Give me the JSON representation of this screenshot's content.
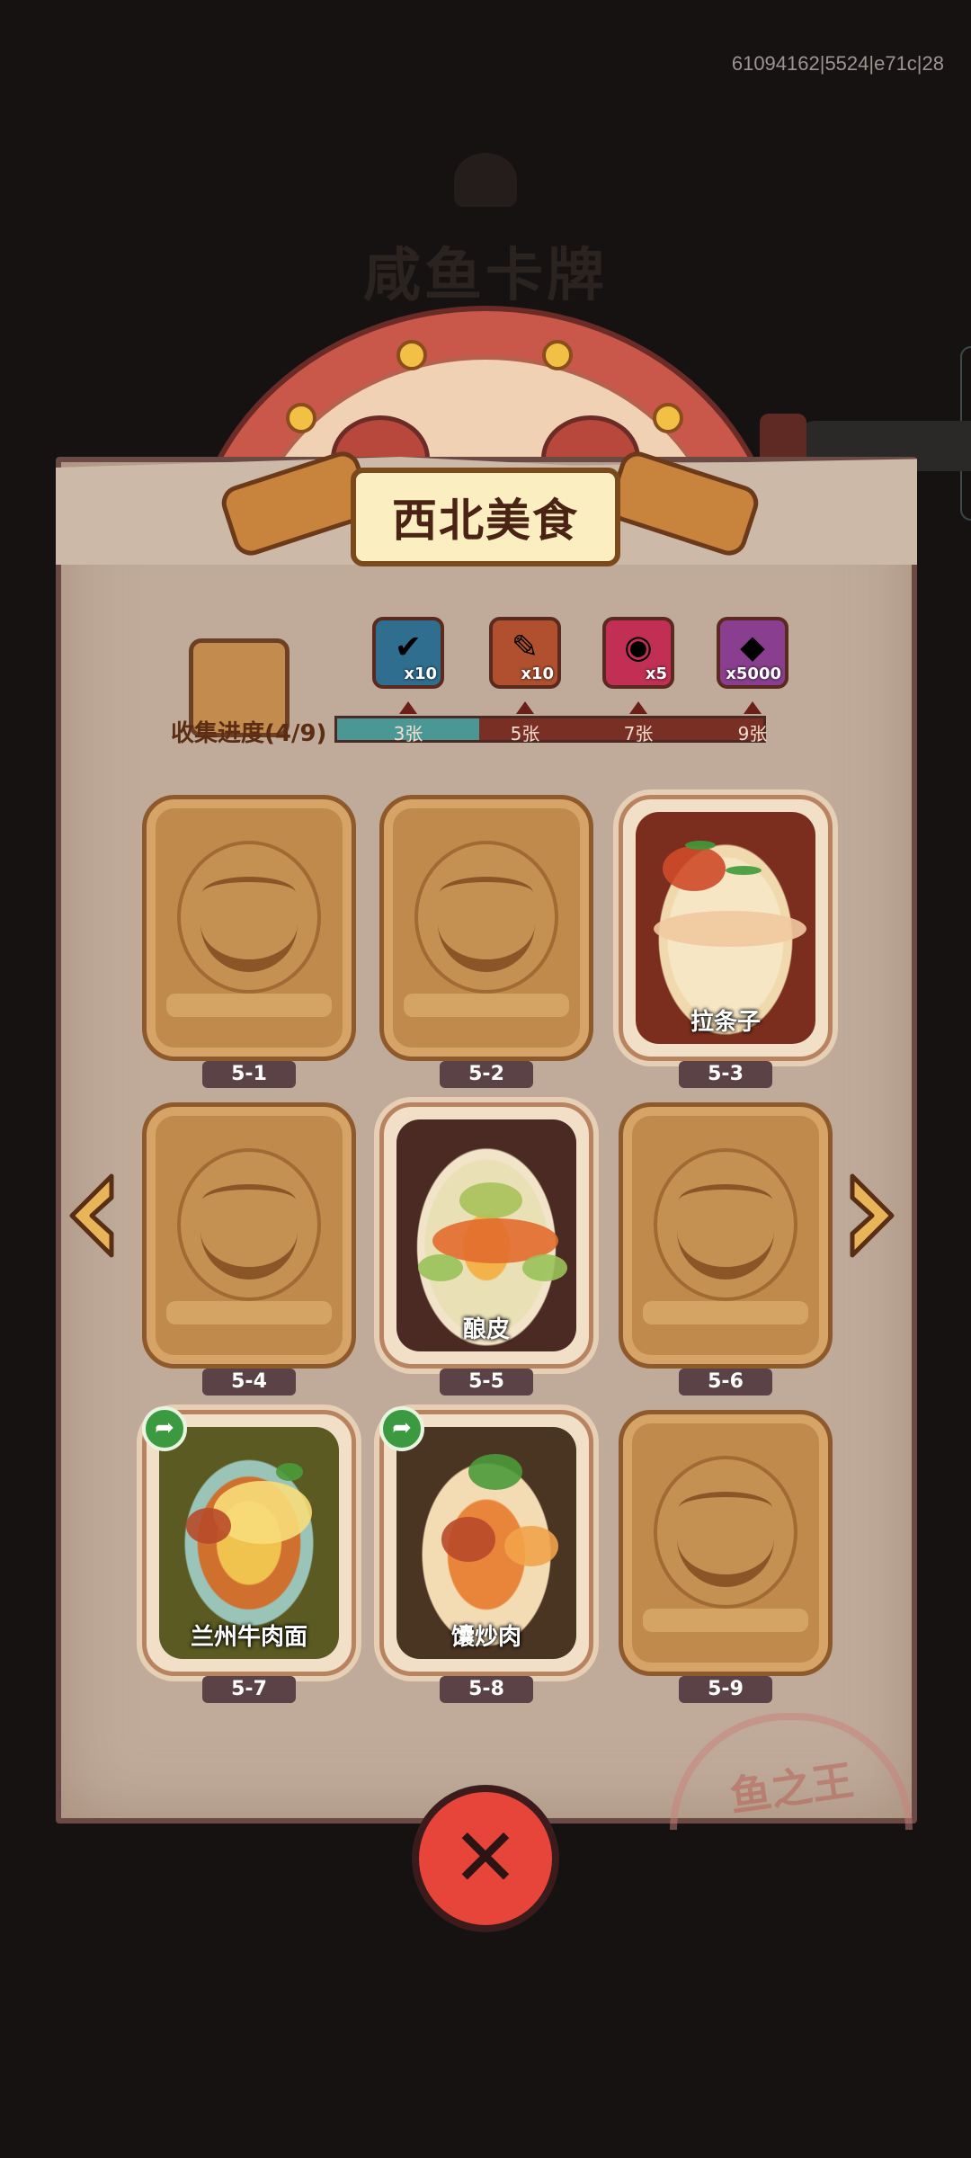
{
  "debug_label": "61094162|5524|e71c|28",
  "background_title": "咸鱼卡牌",
  "panel": {
    "title": "西北美食",
    "progress_label": "收集进度(4/9)",
    "progress_fraction": 0.333,
    "rewards": [
      {
        "icon": "chest-check-icon",
        "amount": "x10",
        "color": "#2f6e8f",
        "threshold": "3张"
      },
      {
        "icon": "scroll-key-icon",
        "amount": "x10",
        "color": "#b0502e",
        "threshold": "5张"
      },
      {
        "icon": "purple-orb-icon",
        "amount": "x5",
        "color": "#c22f55",
        "threshold": "7张"
      },
      {
        "icon": "crystal-icon",
        "amount": "x5000",
        "color": "#8a3e8f",
        "threshold": "9张"
      }
    ]
  },
  "cards": [
    {
      "id": "5-1",
      "name": "",
      "unlocked": false,
      "share": false
    },
    {
      "id": "5-2",
      "name": "",
      "unlocked": false,
      "share": false
    },
    {
      "id": "5-3",
      "name": "拉条子",
      "unlocked": true,
      "share": false,
      "art": "noodles-peppers"
    },
    {
      "id": "5-4",
      "name": "",
      "unlocked": false,
      "share": false
    },
    {
      "id": "5-5",
      "name": "酿皮",
      "unlocked": true,
      "share": false,
      "art": "liangpi"
    },
    {
      "id": "5-6",
      "name": "",
      "unlocked": false,
      "share": false
    },
    {
      "id": "5-7",
      "name": "兰州牛肉面",
      "unlocked": true,
      "share": true,
      "art": "beef-noodle-soup"
    },
    {
      "id": "5-8",
      "name": "馕炒肉",
      "unlocked": true,
      "share": true,
      "art": "nang-stir-fry"
    },
    {
      "id": "5-9",
      "name": "",
      "unlocked": false,
      "share": false
    }
  ],
  "stamp_text": "鱼之王",
  "close_icon": "close-x-icon",
  "share_icon": "share-arrow-icon",
  "colors": {
    "accent_teal": "#4a9796",
    "close_red": "#e8453a"
  }
}
